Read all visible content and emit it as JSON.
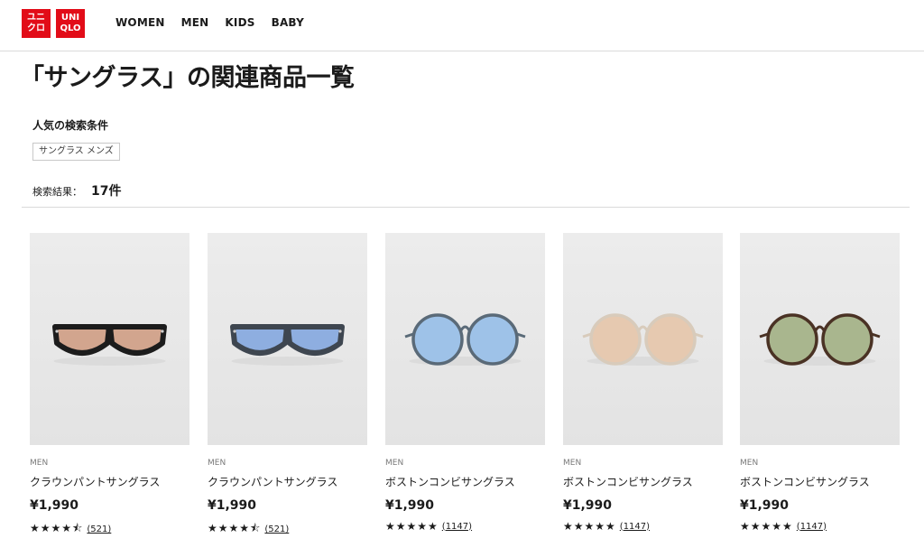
{
  "brand": {
    "logo_text_1": "ユニクロ",
    "logo_text_2": "UNIQLO",
    "logo_box_1_line1": "ユニ",
    "logo_box_1_line2": "クロ",
    "logo_box_2_line1": "UNI",
    "logo_box_2_line2": "QLO",
    "color": "#e20c18"
  },
  "nav": {
    "items": [
      {
        "label": "WOMEN"
      },
      {
        "label": "MEN"
      },
      {
        "label": "KIDS"
      },
      {
        "label": "BABY"
      }
    ]
  },
  "page": {
    "title": "「サングラス」の関連商品一覧",
    "popular_label": "人気の検索条件",
    "popular_tag": "サングラス メンズ",
    "result_label": "検索結果：",
    "result_count": "17件"
  },
  "products": [
    {
      "gender": "MEN",
      "name": "クラウンパントサングラス",
      "price": "¥1,990",
      "stars": "★★★★⯪",
      "reviews": "(521)",
      "rating": 4.5,
      "frame_color": "#1c1c1c",
      "lens_color": "#d2a58e",
      "style": "crown"
    },
    {
      "gender": "MEN",
      "name": "クラウンパントサングラス",
      "price": "¥1,990",
      "stars": "★★★★⯪",
      "reviews": "(521)",
      "rating": 4.5,
      "frame_color": "#3e4650",
      "lens_color": "#8eaee0",
      "style": "crown"
    },
    {
      "gender": "MEN",
      "name": "ボストンコンビサングラス",
      "price": "¥1,990",
      "stars": "★★★★★",
      "reviews": "(1147)",
      "rating": 5,
      "frame_color": "#5a6a78",
      "lens_color": "#9ec2e8",
      "style": "boston"
    },
    {
      "gender": "MEN",
      "name": "ボストンコンビサングラス",
      "price": "¥1,990",
      "stars": "★★★★★",
      "reviews": "(1147)",
      "rating": 5,
      "frame_color": "#d8cbbb",
      "lens_color": "#e6c9b0",
      "style": "boston"
    },
    {
      "gender": "MEN",
      "name": "ボストンコンビサングラス",
      "price": "¥1,990",
      "stars": "★★★★★",
      "reviews": "(1147)",
      "rating": 5,
      "frame_color": "#4a3224",
      "lens_color": "#a9b68e",
      "style": "boston"
    }
  ]
}
